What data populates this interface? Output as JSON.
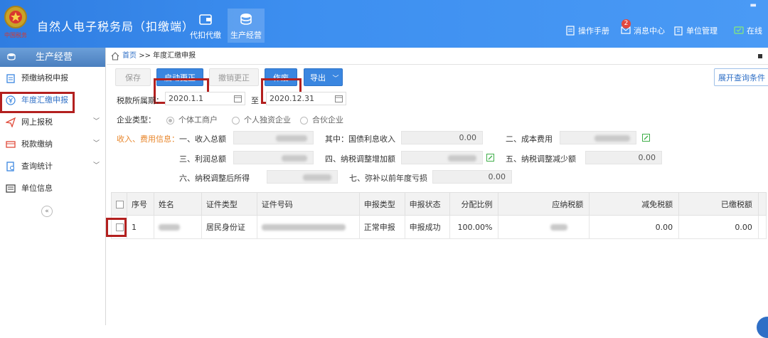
{
  "header": {
    "title": "自然人电子税务局（扣缴端）",
    "nav": [
      {
        "label": "代扣代缴",
        "icon": "wallet-icon",
        "active": false
      },
      {
        "label": "生产经营",
        "icon": "coins-icon",
        "active": true
      }
    ],
    "links": [
      {
        "label": "操作手册",
        "icon": "manual-icon"
      },
      {
        "label": "消息中心",
        "icon": "message-icon",
        "badge": "2"
      },
      {
        "label": "单位管理",
        "icon": "building-icon"
      },
      {
        "label": "在线",
        "icon": "online-icon"
      }
    ],
    "logo_text": "中国税务"
  },
  "sidebar": {
    "title": "生产经营",
    "items": [
      {
        "label": "预缴纳税申报",
        "icon": "clipboard-icon",
        "chevron": false,
        "active": false
      },
      {
        "label": "年度汇缴申报",
        "icon": "yen-icon",
        "chevron": false,
        "active": true
      },
      {
        "label": "网上报税",
        "icon": "send-icon",
        "chevron": true,
        "active": false
      },
      {
        "label": "税款缴纳",
        "icon": "payment-icon",
        "chevron": true,
        "active": false
      },
      {
        "label": "查询统计",
        "icon": "query-icon",
        "chevron": true,
        "active": false
      },
      {
        "label": "单位信息",
        "icon": "list-icon",
        "chevron": false,
        "active": false
      }
    ],
    "collapse": "«"
  },
  "breadcrumb": {
    "home": "首页",
    "sep": ">>",
    "current": "年度汇缴申报"
  },
  "toolbar": {
    "save": "保存",
    "start_correction": "启动更正",
    "cancel_correction": "撤销更正",
    "void": "作废",
    "export": "导出",
    "expand_query": "展开查询条件"
  },
  "period": {
    "label": "税款所属期：",
    "from": "2020.1.1",
    "to_label": "至",
    "to": "2020.12.31"
  },
  "enterprise_type": {
    "label": "企业类型：",
    "options": [
      "个体工商户",
      "个人独资企业",
      "合伙企业"
    ],
    "selected": "个体工商户"
  },
  "income": {
    "section_label": "收入、费用信息：",
    "total_income": "一、收入总额",
    "bond_interest": "其中：国债利息收入",
    "bond_interest_value": "0.00",
    "cost": "二、成本费用",
    "total_profit": "三、利润总额",
    "tax_adj_increase": "四、纳税调整增加额",
    "tax_adj_decrease": "五、纳税调整减少额",
    "tax_adj_decrease_value": "0.00",
    "after_adj_income": "六、纳税调整后所得",
    "prior_loss": "七、弥补以前年度亏损",
    "prior_loss_value": "0.00"
  },
  "table": {
    "headers": [
      "序号",
      "姓名",
      "证件类型",
      "证件号码",
      "申报类型",
      "申报状态",
      "分配比例",
      "应纳税额",
      "减免税额",
      "已缴税额"
    ],
    "rows": [
      {
        "seq": "1",
        "id_type": "居民身份证",
        "report_type": "正常申报",
        "status": "申报成功",
        "ratio": "100.00%",
        "relief": "0.00",
        "paid": "0.00"
      }
    ]
  },
  "colors": {
    "header_blue": "#3d8ff0",
    "primary": "#3a86e0",
    "highlight": "#b3201f",
    "orange": "#e8862b"
  }
}
